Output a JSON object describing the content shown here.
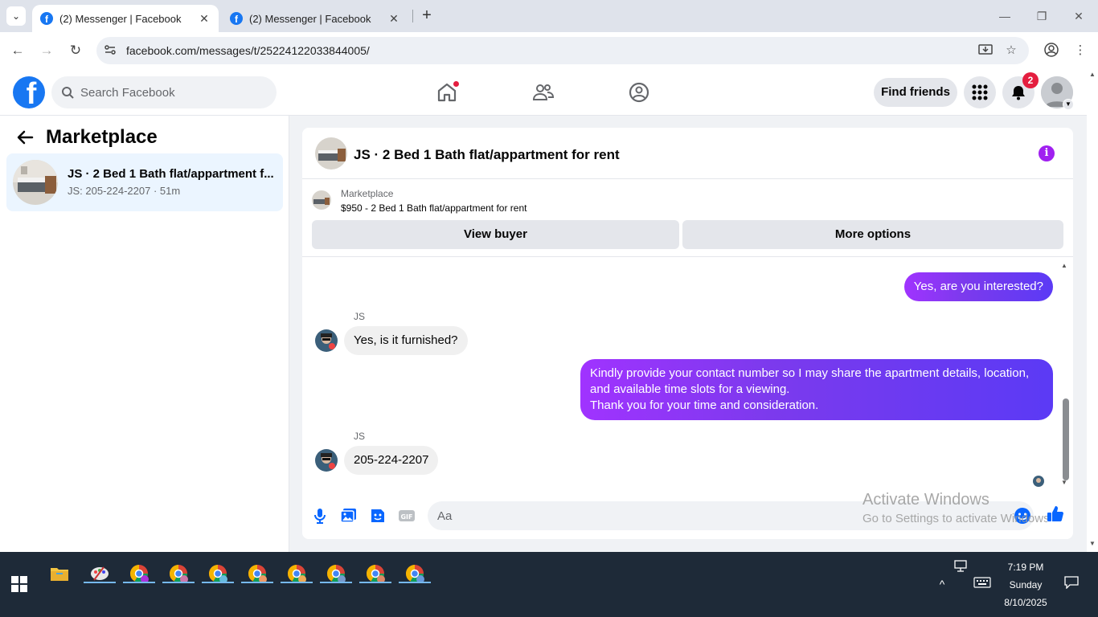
{
  "browser": {
    "tabs": [
      {
        "title": "(2) Messenger | Facebook",
        "active": true
      },
      {
        "title": "(2) Messenger | Facebook",
        "active": false
      }
    ],
    "url": "facebook.com/messages/t/25224122033844005/"
  },
  "fb_header": {
    "search_placeholder": "Search Facebook",
    "find_friends_label": "Find friends",
    "notification_count": "2",
    "brand_color": "#1877f2"
  },
  "left_pane": {
    "title": "Marketplace",
    "conversation": {
      "name": "JS · 2 Bed 1 Bath flat/appartment f...",
      "subtitle": "JS: 205-224-2207 · 51m"
    }
  },
  "chat": {
    "title": "JS · 2 Bed 1 Bath flat/appartment for rent",
    "marketplace_label": "Marketplace",
    "listing": "$950 - 2 Bed 1 Bath flat/appartment for rent",
    "view_buyer_label": "View buyer",
    "more_options_label": "More options",
    "messages": [
      {
        "from": "me",
        "text": "Yes, are you interested?"
      },
      {
        "from": "JS",
        "sender": "JS",
        "text": "Yes, is it furnished?"
      },
      {
        "from": "me",
        "lines": [
          "Kindly provide your contact number so I may share the apartment details, location,",
          "and available time slots for a viewing.",
          "Thank you for your time and consideration."
        ]
      },
      {
        "from": "JS",
        "sender": "JS",
        "text": "205-224-2207"
      }
    ],
    "composer_placeholder": "Aa",
    "accent_color": "#7c3aed"
  },
  "watermark": {
    "line1": "Activate Windows",
    "line2": "Go to Settings to activate Windows."
  },
  "taskbar": {
    "time": "7:19 PM",
    "day": "Sunday",
    "date": "8/10/2025"
  }
}
